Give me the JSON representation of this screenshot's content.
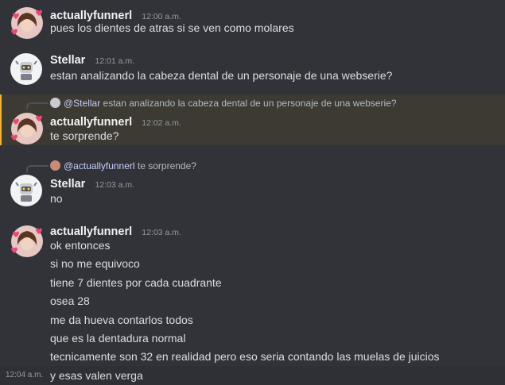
{
  "messages": [
    {
      "author": "actuallyfunnerl",
      "timestamp": "12:00 a.m.",
      "lines": [
        "pues los dientes de atras si se ven como molares"
      ]
    },
    {
      "author": "Stellar",
      "timestamp": "12:01 a.m.",
      "lines": [
        "estan analizando la cabeza dental de un personaje de una webserie?"
      ]
    },
    {
      "author": "actuallyfunnerl",
      "timestamp": "12:02 a.m.",
      "reply_to": {
        "mention": "@Stellar",
        "text": "estan analizando la cabeza dental de un personaje de una webserie?"
      },
      "lines": [
        "te sorprende?"
      ]
    },
    {
      "author": "Stellar",
      "timestamp": "12:03 a.m.",
      "reply_to": {
        "mention": "@actuallyfunnerl",
        "text": "te sorprende?"
      },
      "lines": [
        "no"
      ]
    },
    {
      "author": "actuallyfunnerl",
      "timestamp": "12:03 a.m.",
      "lines": [
        "ok entonces",
        "si no me equivoco",
        "tiene 7 dientes por cada cuadrante",
        "osea 28",
        "me da hueva contarlos todos",
        "que es la dentadura normal",
        "tecnicamente son 32 en realidad pero eso seria contando las muelas de juicios"
      ]
    }
  ],
  "last_line": {
    "timestamp": "12:04 a.m.",
    "text": "y esas valen verga"
  },
  "colors": {
    "background": "#313338",
    "highlight": "#3c3a33",
    "highlight_bar": "#f0b232",
    "mention": "#c9cdfb"
  }
}
